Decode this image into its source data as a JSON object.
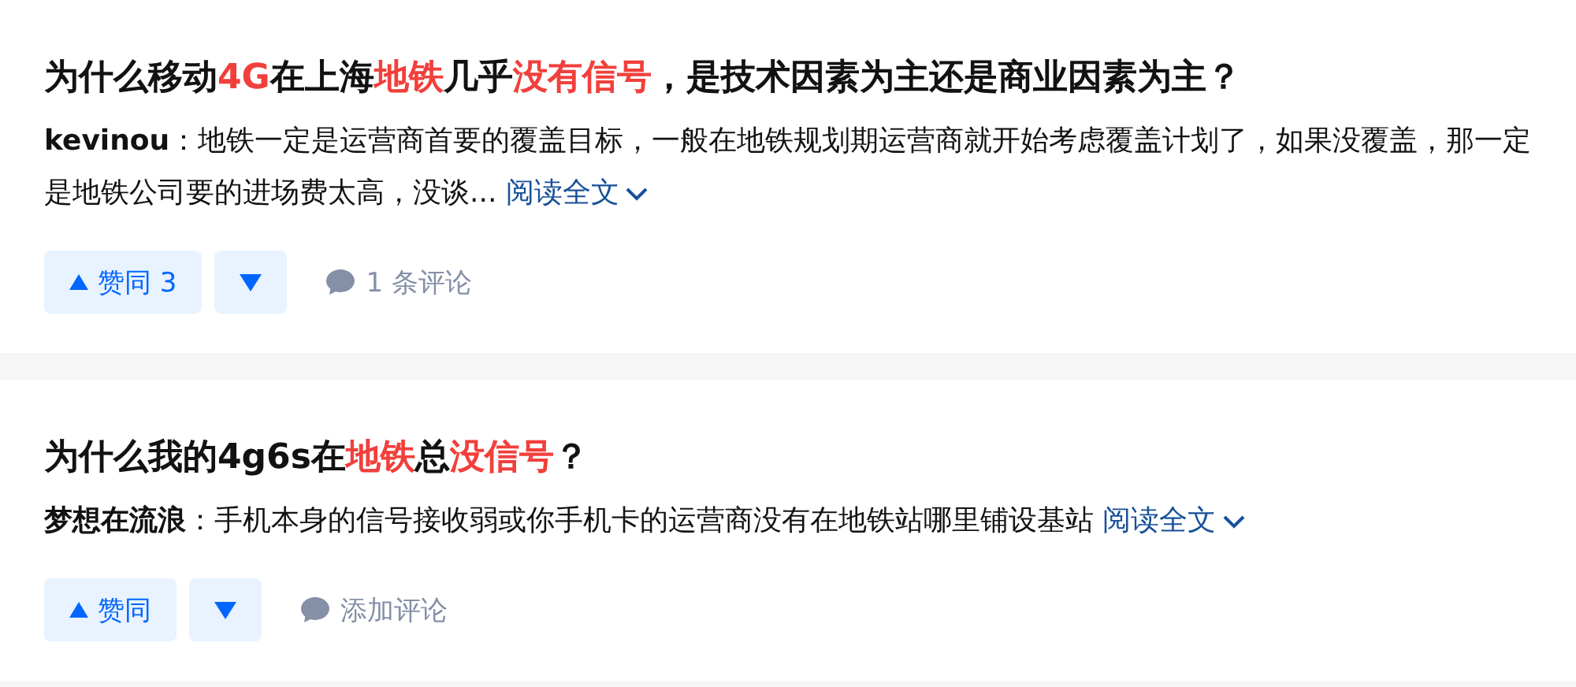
{
  "results": [
    {
      "title": [
        {
          "text": "为什么移动",
          "highlight": false
        },
        {
          "text": "4G",
          "highlight": true
        },
        {
          "text": "在上海",
          "highlight": false
        },
        {
          "text": "地铁",
          "highlight": true
        },
        {
          "text": "几乎",
          "highlight": false
        },
        {
          "text": "没有信号",
          "highlight": true
        },
        {
          "text": "，是技术因素为主还是商业因素为主？",
          "highlight": false
        }
      ],
      "excerpt": "**kevinou**：地铁一定是运营商首要的覆盖目标，一般在地铁规划期运营商就开始考虑覆盖计划了，如果没覆盖，那一定是地铁公司要的进场费太高，没谈...",
      "read_more": "阅读全文",
      "vote_label": "赞同 3",
      "comment_label": "1 条评论"
    },
    {
      "title": [
        {
          "text": "为什么我的4g6s在",
          "highlight": false
        },
        {
          "text": "地铁",
          "highlight": true
        },
        {
          "text": "总",
          "highlight": false
        },
        {
          "text": "没信号",
          "highlight": true
        },
        {
          "text": "？",
          "highlight": false
        }
      ],
      "excerpt": "**梦想在流浪**：手机本身的信号接收弱或你手机卡的运营商没有在地铁站哪里铺设基站",
      "read_more": "阅读全文",
      "vote_label": "赞同",
      "comment_label": "添加评论"
    }
  ]
}
